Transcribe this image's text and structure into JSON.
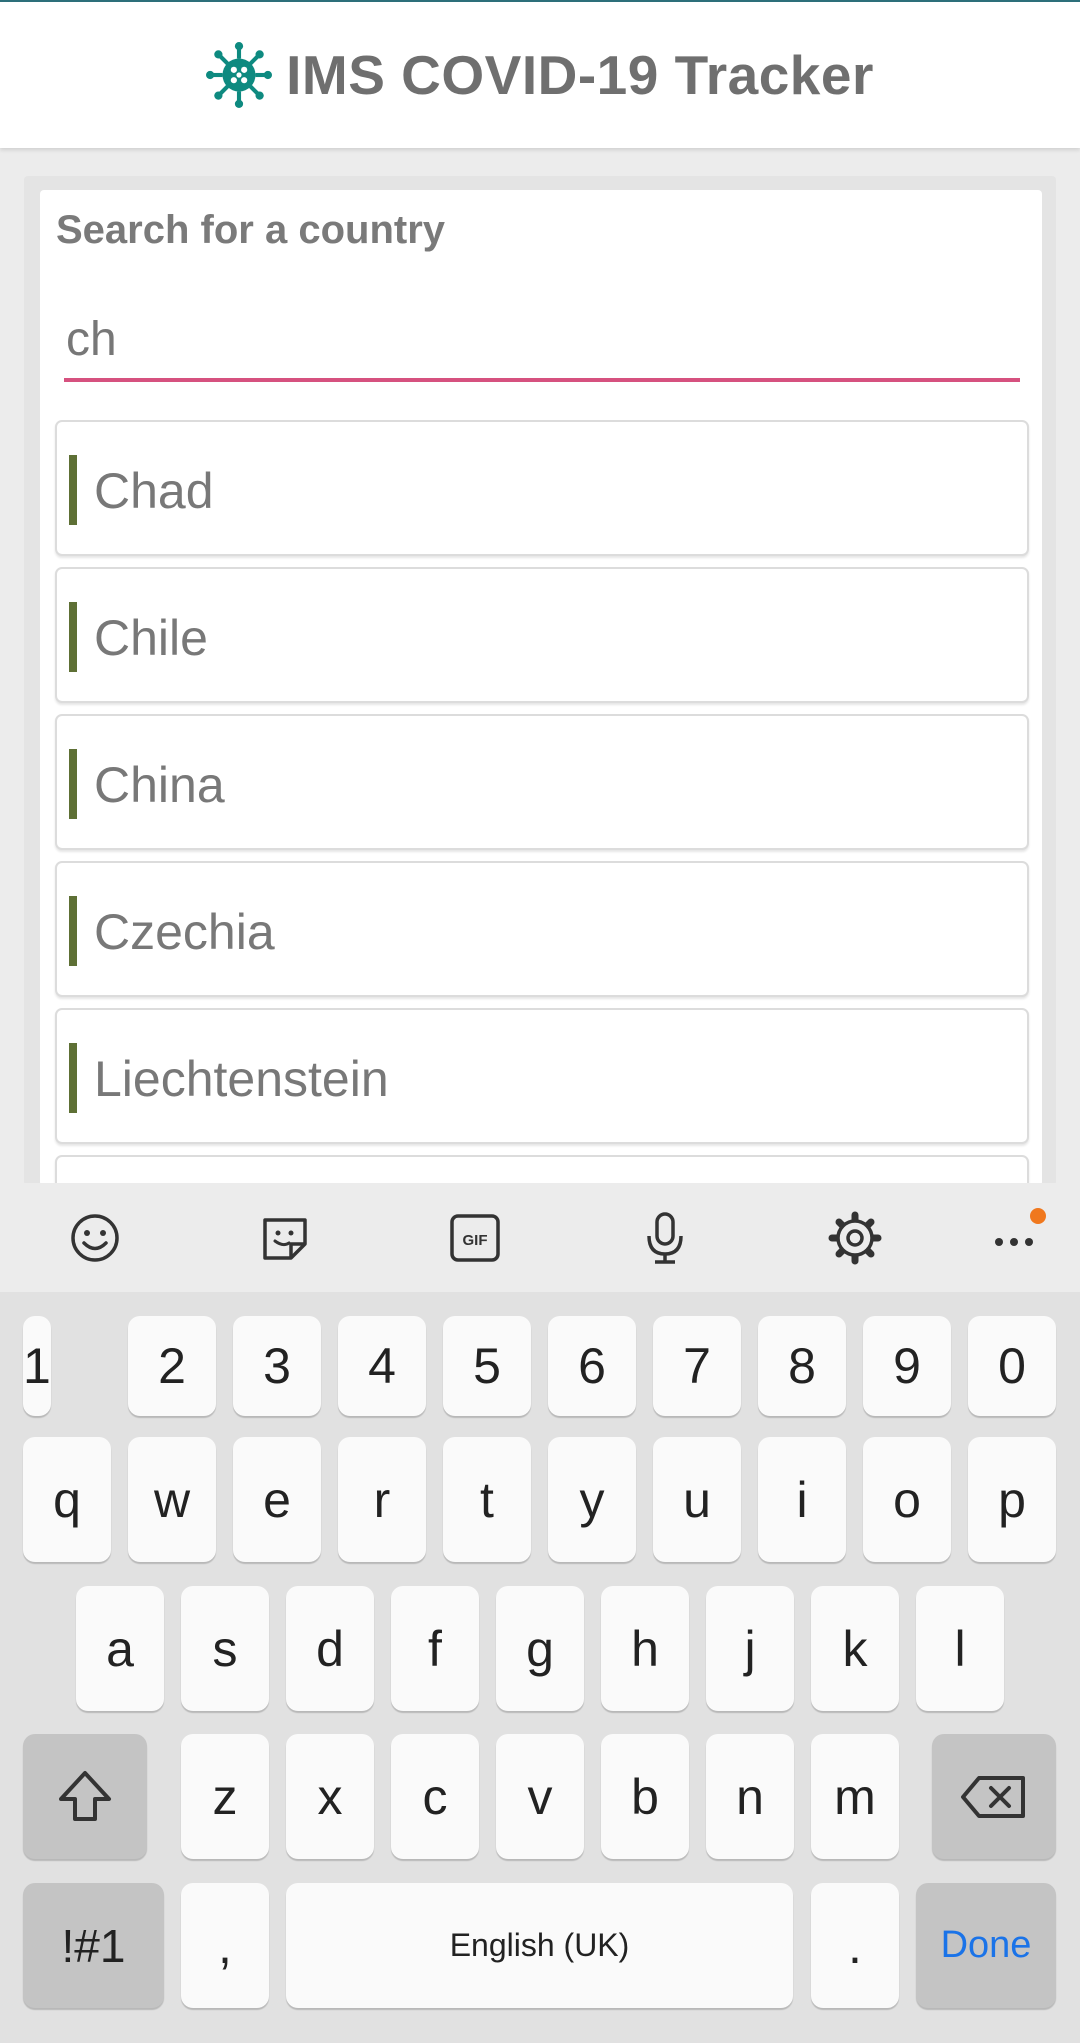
{
  "app": {
    "title": "IMS COVID-19 Tracker",
    "logo_icon": "virus-icon",
    "brand_color": "#0e8a80"
  },
  "search": {
    "label": "Search for a country",
    "value": "ch",
    "underline_color": "#d6517f"
  },
  "countries": [
    "Chad",
    "Chile",
    "China",
    "Czechia",
    "Liechtenstein"
  ],
  "keyboard": {
    "toolbar": [
      "emoji-icon",
      "sticker-icon",
      "gif-icon",
      "microphone-icon",
      "settings-icon",
      "more-icon"
    ],
    "gif_label": "GIF",
    "row_numbers": [
      "1",
      "2",
      "3",
      "4",
      "5",
      "6",
      "7",
      "8",
      "9",
      "0"
    ],
    "row_1": [
      "q",
      "w",
      "e",
      "r",
      "t",
      "y",
      "u",
      "i",
      "o",
      "p"
    ],
    "row_2": [
      "a",
      "s",
      "d",
      "f",
      "g",
      "h",
      "j",
      "k",
      "l"
    ],
    "row_3": [
      "z",
      "x",
      "c",
      "v",
      "b",
      "n",
      "m"
    ],
    "symbols_label": "!#1",
    "comma_label": ",",
    "space_label": "English (UK)",
    "period_label": ".",
    "done_label": "Done"
  }
}
